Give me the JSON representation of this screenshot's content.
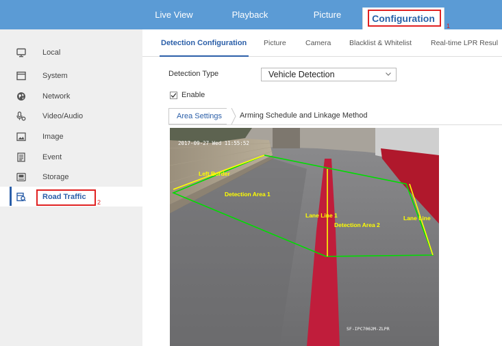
{
  "top_nav": {
    "items": [
      {
        "label": "Live View"
      },
      {
        "label": "Playback"
      },
      {
        "label": "Picture"
      },
      {
        "label": "Configuration",
        "active": true
      }
    ],
    "marker": "1"
  },
  "sidebar": {
    "items": [
      {
        "label": "Local",
        "icon": "monitor-icon"
      },
      {
        "label": "System",
        "icon": "system-window-icon"
      },
      {
        "label": "Network",
        "icon": "globe-icon"
      },
      {
        "label": "Video/Audio",
        "icon": "microphone-icon"
      },
      {
        "label": "Image",
        "icon": "image-icon"
      },
      {
        "label": "Event",
        "icon": "event-list-icon"
      },
      {
        "label": "Storage",
        "icon": "storage-icon"
      },
      {
        "label": "Road Traffic",
        "icon": "road-traffic-icon",
        "active": true
      }
    ],
    "marker": "2"
  },
  "sub_tabs": {
    "items": [
      {
        "label": "Detection Configuration",
        "active": true
      },
      {
        "label": "Picture"
      },
      {
        "label": "Camera"
      },
      {
        "label": "Blacklist & Whitelist"
      },
      {
        "label": "Real-time LPR Resul"
      }
    ]
  },
  "form": {
    "detection_type_label": "Detection Type",
    "detection_type_value": "Vehicle Detection",
    "enable_label": "Enable",
    "enable_checked": true
  },
  "step_tabs": {
    "area_settings": "Area Settings",
    "arming_schedule": "Arming Schedule and Linkage Method"
  },
  "video": {
    "timestamp": "2017-09-27 Wed 11:55:52",
    "labels": {
      "left_border": "Left Border",
      "detection_area_1": "Detection Area 1",
      "lane_line_1": "Lane Line 1",
      "detection_area_2": "Detection Area 2",
      "lane_line_2": "Lane Line"
    },
    "camera_model": "SF-IPC7062M-ZLPR"
  },
  "colors": {
    "top_bar": "#5b9bd5",
    "accent": "#2a5ea8",
    "highlight_box": "#e02020",
    "overlay_yellow": "#ffff00",
    "overlay_green": "#00dd00"
  }
}
